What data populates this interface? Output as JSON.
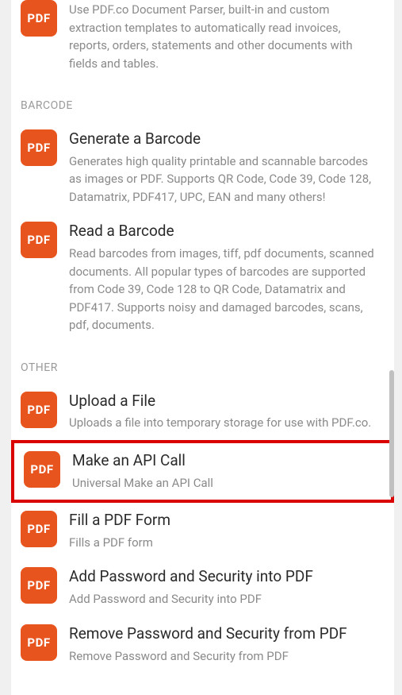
{
  "icon_label": "PDF",
  "top_item_desc": "Use PDF.co Document Parser, built-in and custom extraction templates to automatically read invoices, reports, orders, statements and other documents with fields and tables.",
  "sections": [
    {
      "header": "BARCODE",
      "items": [
        {
          "title": "Generate a Barcode",
          "desc": "Generates high quality printable and scannable barcodes as images or PDF. Supports QR Code, Code 39, Code 128, Datamatrix, PDF417, UPC, EAN and many others!"
        },
        {
          "title": "Read a Barcode",
          "desc": "Read barcodes from images, tiff, pdf documents, scanned documents. All popular types of barcodes are supported from Code 39, Code 128 to QR Code, Datamatrix and PDF417. Supports noisy and damaged barcodes, scans, pdf, documents."
        }
      ]
    },
    {
      "header": "OTHER",
      "items": [
        {
          "title": "Upload a File",
          "desc": "Uploads a file into temporary storage for use with PDF.co."
        },
        {
          "title": "Make an API Call",
          "desc": "Universal Make an API Call",
          "highlighted": true
        },
        {
          "title": "Fill a PDF Form",
          "desc": "Fills a PDF form"
        },
        {
          "title": "Add Password and Security into PDF",
          "desc": "Add Password and Security into PDF"
        },
        {
          "title": "Remove Password and Security from PDF",
          "desc": "Remove Password and Security from PDF"
        }
      ]
    }
  ]
}
